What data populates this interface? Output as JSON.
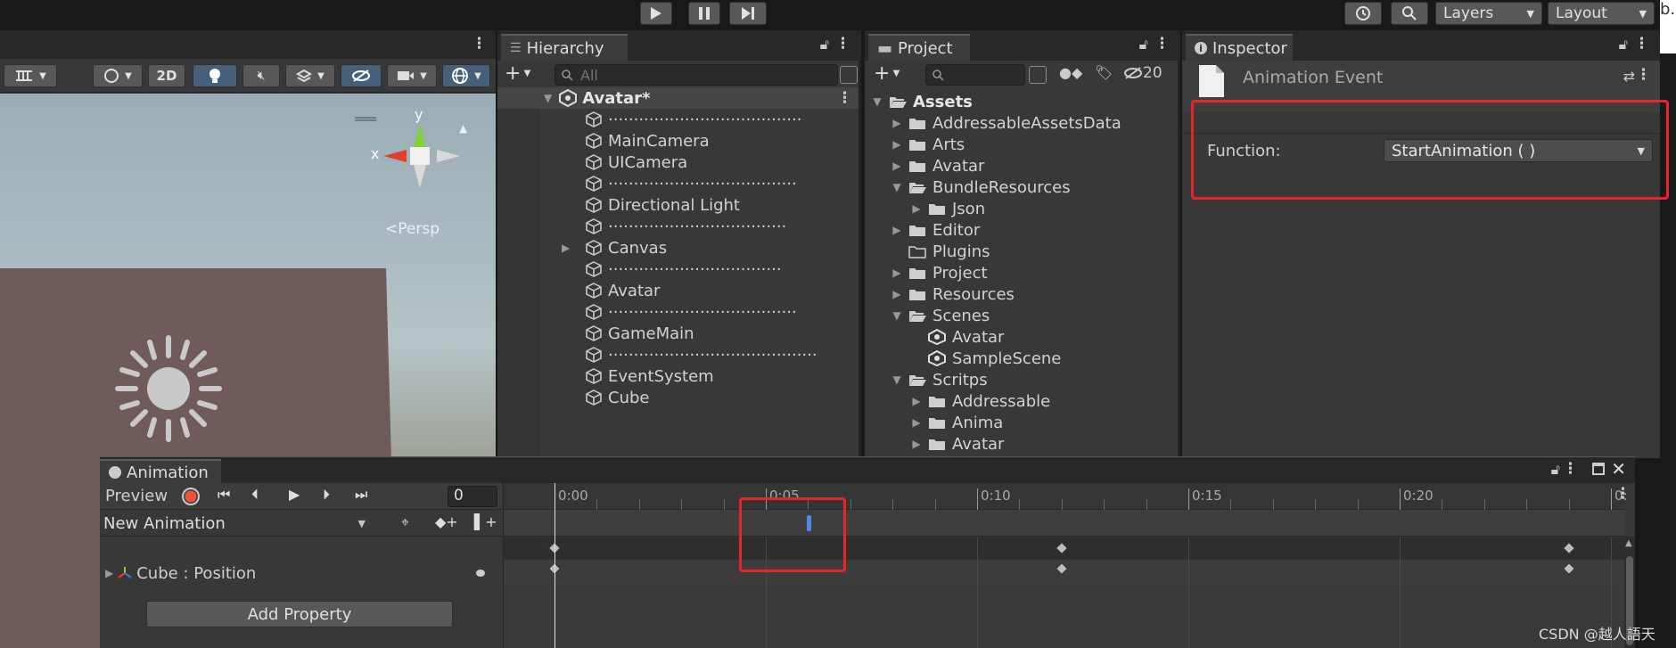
{
  "toolbar": {
    "play_icon": "play-icon",
    "pause_icon": "pause-icon",
    "step_icon": "step-icon",
    "layers": "Layers",
    "layout": "Layout",
    "browser_partial": "b.c"
  },
  "scene": {
    "tool_2d": "2D",
    "gizmo_y": "y",
    "gizmo_x": "x",
    "persp": "Persp"
  },
  "hierarchy": {
    "tab": "Hierarchy",
    "search_placeholder": "All",
    "root": "Avatar*",
    "items": [
      {
        "label": "······································",
        "expander": false
      },
      {
        "label": "MainCamera",
        "expander": false
      },
      {
        "label": "UICamera",
        "expander": false
      },
      {
        "label": "·····································",
        "expander": false
      },
      {
        "label": "Directional Light",
        "expander": false
      },
      {
        "label": "···································",
        "expander": false
      },
      {
        "label": "Canvas",
        "expander": true
      },
      {
        "label": "··································",
        "expander": false
      },
      {
        "label": "Avatar",
        "expander": false
      },
      {
        "label": "·····································",
        "expander": false
      },
      {
        "label": "GameMain",
        "expander": false
      },
      {
        "label": "·········································",
        "expander": false
      },
      {
        "label": "EventSystem",
        "expander": false
      },
      {
        "label": "Cube",
        "expander": false
      }
    ]
  },
  "project": {
    "tab": "Project",
    "hidden_count": "20",
    "items": [
      {
        "label": "Assets",
        "depth": 0,
        "arrow": "down",
        "icon": "folder-open",
        "bold": true
      },
      {
        "label": "AddressableAssetsData",
        "depth": 1,
        "arrow": "right",
        "icon": "folder"
      },
      {
        "label": "Arts",
        "depth": 1,
        "arrow": "right",
        "icon": "folder"
      },
      {
        "label": "Avatar",
        "depth": 1,
        "arrow": "right",
        "icon": "folder"
      },
      {
        "label": "BundleResources",
        "depth": 1,
        "arrow": "down",
        "icon": "folder-open"
      },
      {
        "label": "Json",
        "depth": 2,
        "arrow": "right",
        "icon": "folder"
      },
      {
        "label": "Editor",
        "depth": 1,
        "arrow": "right",
        "icon": "folder"
      },
      {
        "label": "Plugins",
        "depth": 1,
        "arrow": "none",
        "icon": "folder-empty"
      },
      {
        "label": "Project",
        "depth": 1,
        "arrow": "right",
        "icon": "folder"
      },
      {
        "label": "Resources",
        "depth": 1,
        "arrow": "right",
        "icon": "folder"
      },
      {
        "label": "Scenes",
        "depth": 1,
        "arrow": "down",
        "icon": "folder-open"
      },
      {
        "label": "Avatar",
        "depth": 2,
        "arrow": "none",
        "icon": "unity"
      },
      {
        "label": "SampleScene",
        "depth": 2,
        "arrow": "none",
        "icon": "unity"
      },
      {
        "label": "Scritps",
        "depth": 1,
        "arrow": "down",
        "icon": "folder-open"
      },
      {
        "label": "Addressable",
        "depth": 2,
        "arrow": "right",
        "icon": "folder"
      },
      {
        "label": "Anima",
        "depth": 2,
        "arrow": "right",
        "icon": "folder"
      },
      {
        "label": "Avatar",
        "depth": 2,
        "arrow": "right",
        "icon": "folder"
      }
    ]
  },
  "inspector": {
    "tab": "Inspector",
    "title": "Animation Event",
    "function_label": "Function:",
    "function_value": "StartAnimation ( )"
  },
  "animation": {
    "tab": "Animation",
    "preview": "Preview",
    "frame": "0",
    "clip": "New Animation",
    "property": "Cube : Position",
    "add_property": "Add Property",
    "time_labels": [
      "0:00",
      "0:05",
      "0:10",
      "0:15",
      "0:20",
      "0:"
    ]
  },
  "watermark": "CSDN @越人語天",
  "colors": {
    "highlight": "#e8232a",
    "accent_blue": "#4d7bbf",
    "panel": "#383838"
  }
}
